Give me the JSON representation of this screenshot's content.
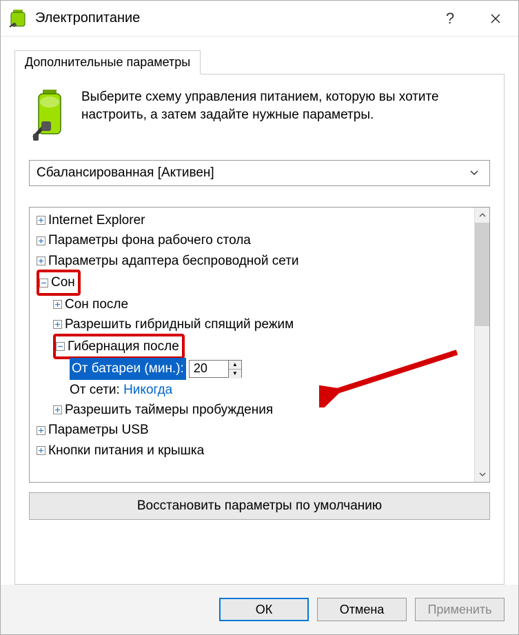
{
  "title": "Электропитание",
  "tab": "Дополнительные параметры",
  "intro": "Выберите схему управления питанием, которую вы хотите настроить, а затем задайте нужные параметры.",
  "plan": "Сбалансированная [Активен]",
  "tree": {
    "ie": "Internet Explorer",
    "desktop_bg": "Параметры фона рабочего стола",
    "wifi": "Параметры адаптера беспроводной сети",
    "sleep": "Сон",
    "sleep_after": "Сон после",
    "hybrid": "Разрешить гибридный спящий режим",
    "hibernate": "Гибернация после",
    "on_battery_label": "От батареи (мин.):",
    "on_battery_value": "20",
    "plugged_label": "От сети:",
    "plugged_value": "Никогда",
    "wake_timers": "Разрешить таймеры пробуждения",
    "usb": "Параметры USB",
    "power_buttons": "Кнопки питания и крышка"
  },
  "restore": "Восстановить параметры по умолчанию",
  "buttons": {
    "ok": "ОК",
    "cancel": "Отмена",
    "apply": "Применить"
  }
}
